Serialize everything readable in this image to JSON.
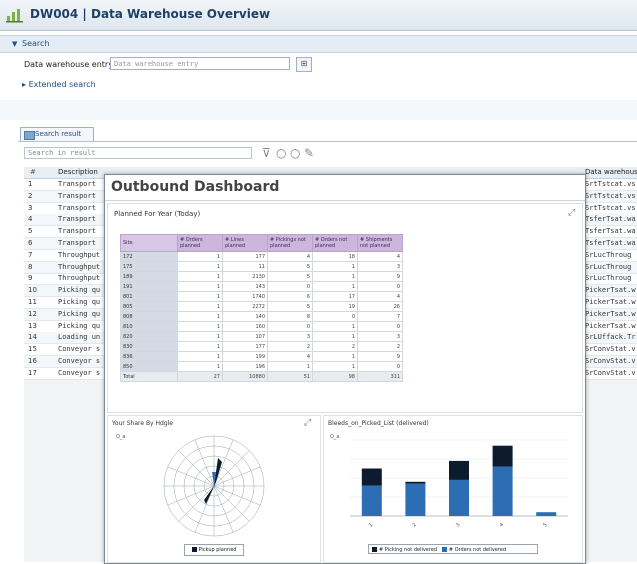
{
  "window": {
    "title": "DW004 | Data Warehouse Overview"
  },
  "search": {
    "header": "Search",
    "dw_label": "Data warehouse entry:",
    "dw_placeholder": "Data warehouse entry",
    "extended_search": "Extended search"
  },
  "result": {
    "tab_label": "Search result",
    "filter_placeholder": "Search in result",
    "header_hash": "#",
    "header_desc": "Description",
    "header_right": "Data warehouse e",
    "rows": [
      {
        "n": "1",
        "d": "Transport",
        "r": "SrtTstcat.vs"
      },
      {
        "n": "2",
        "d": "Transport",
        "r": "SrtTstcat.vs"
      },
      {
        "n": "3",
        "d": "Transport",
        "r": "SrtTstcat.vs"
      },
      {
        "n": "4",
        "d": "Transport",
        "r": "TsferTsat.wa"
      },
      {
        "n": "5",
        "d": "Transport",
        "r": "TsferTsat.wa"
      },
      {
        "n": "6",
        "d": "Transport",
        "r": "TsferTsat.wa"
      },
      {
        "n": "7",
        "d": "Throughput",
        "r": "SrLucThroug"
      },
      {
        "n": "8",
        "d": "Throughput",
        "r": "SrLucThroug"
      },
      {
        "n": "9",
        "d": "Throughput",
        "r": "SrLucThroug"
      },
      {
        "n": "10",
        "d": "Picking qu",
        "r": "PickerTsat.w"
      },
      {
        "n": "11",
        "d": "Picking qu",
        "r": "PickerTsat.w"
      },
      {
        "n": "12",
        "d": "Picking qu",
        "r": "PickerTsat.w"
      },
      {
        "n": "13",
        "d": "Picking qu",
        "r": "PickerTsat.w"
      },
      {
        "n": "14",
        "d": "Loading un",
        "r": "SrLUffack.Tr"
      },
      {
        "n": "15",
        "d": "Conveyor s",
        "r": "SrConvStat.v"
      },
      {
        "n": "16",
        "d": "Conveyor s",
        "r": "SrConvStat.v"
      },
      {
        "n": "17",
        "d": "Conveyor s",
        "r": "SrConvStat.v"
      }
    ]
  },
  "dashboard": {
    "title": "Outbound Dashboard",
    "planned": {
      "title": "Planned For Year (Today)",
      "headers": [
        "Site",
        "# Orders planned",
        "# Lines planned",
        "# Pickings not planned",
        "# Orders not planned",
        "# Shipments not planned"
      ],
      "rows": [
        [
          "172",
          "1",
          "177",
          "4",
          "18",
          "4"
        ],
        [
          "175",
          "1",
          "11",
          "5",
          "1",
          "3"
        ],
        [
          "189",
          "1",
          "2130",
          "5",
          "1",
          "9"
        ],
        [
          "191",
          "1",
          "143",
          "0",
          "1",
          "0"
        ],
        [
          "801",
          "1",
          "1740",
          "6",
          "17",
          "4"
        ],
        [
          "805",
          "1",
          "2272",
          "5",
          "19",
          "26"
        ],
        [
          "808",
          "1",
          "140",
          "8",
          "0",
          "7"
        ],
        [
          "810",
          "1",
          "160",
          "0",
          "1",
          "0"
        ],
        [
          "820",
          "1",
          "107",
          "3",
          "1",
          "3"
        ],
        [
          "830",
          "1",
          "177",
          "2",
          "2",
          "2"
        ],
        [
          "836",
          "1",
          "199",
          "4",
          "1",
          "9"
        ],
        [
          "850",
          "1",
          "196",
          "1",
          "1",
          "0"
        ]
      ],
      "total": [
        "Total",
        "27",
        "10880",
        "51",
        "98",
        "311"
      ]
    },
    "wind": {
      "title": "Your Share By Hdgle",
      "y_label": "Q_a",
      "legend": "Pickup planned"
    },
    "bins": {
      "title": "Bleeds_on_Picked_List (delivered)",
      "y_label": "Q_a",
      "legend_a": "# Picking not delivered",
      "legend_b": "# Orders not delivered"
    }
  },
  "chart_data": [
    {
      "type": "bar",
      "title": "Bleeds_on_Picked_List (delivered)",
      "categories": [
        "1",
        "2",
        "3",
        "4",
        "5"
      ],
      "series": [
        {
          "name": "# Picking not delivered",
          "values": [
            9,
            1,
            10,
            11,
            0
          ]
        },
        {
          "name": "# Orders not delivered",
          "values": [
            16,
            17,
            19,
            26,
            2
          ]
        }
      ],
      "ylim": [
        0,
        40
      ]
    }
  ],
  "colors": {
    "accent": "#1f4f86",
    "bar_dark": "#0d1b2e",
    "bar_blue": "#2c6db3",
    "header_purple": "#cdb6de"
  }
}
